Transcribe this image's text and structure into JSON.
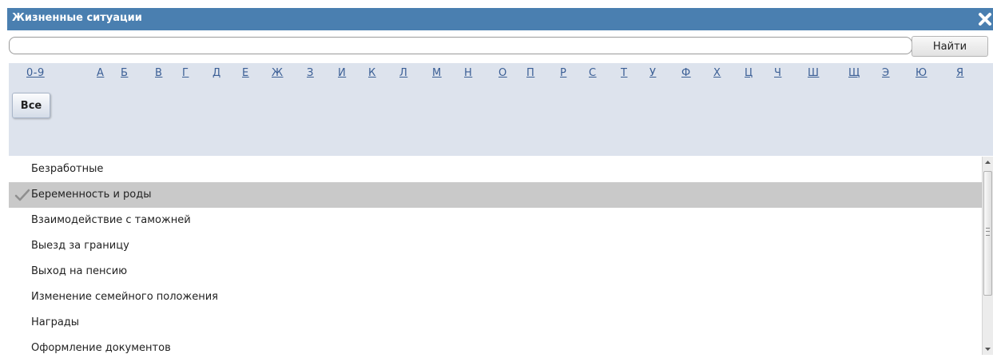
{
  "window": {
    "title": "Жизненные ситуации",
    "close_icon": "close-icon"
  },
  "search": {
    "value": "",
    "placeholder": "",
    "button_label": "Найти"
  },
  "alphabet": {
    "letters": [
      "0-9",
      "А",
      "Б",
      "В",
      "Г",
      "Д",
      "Е",
      "Ж",
      "З",
      "И",
      "К",
      "Л",
      "М",
      "Н",
      "О",
      "П",
      "Р",
      "С",
      "Т",
      "У",
      "Ф",
      "Х",
      "Ц",
      "Ч",
      "Ш",
      "Щ",
      "Э",
      "Ю",
      "Я"
    ],
    "all_label": "Все"
  },
  "list": {
    "items": [
      {
        "label": "Безработные",
        "selected": false
      },
      {
        "label": "Беременность и роды",
        "selected": true
      },
      {
        "label": "Взаимодействие с таможней",
        "selected": false
      },
      {
        "label": "Выезд за границу",
        "selected": false
      },
      {
        "label": "Выход на пенсию",
        "selected": false
      },
      {
        "label": "Изменение семейного положения",
        "selected": false
      },
      {
        "label": "Награды",
        "selected": false
      },
      {
        "label": "Оформление документов",
        "selected": false
      }
    ],
    "selected_icon": "check-icon"
  },
  "colors": {
    "titlebar": "#4a7fb0",
    "alpha_panel": "#dde3ed",
    "letter_link": "#3a5e95",
    "selected_row": "#c9c9c9"
  }
}
